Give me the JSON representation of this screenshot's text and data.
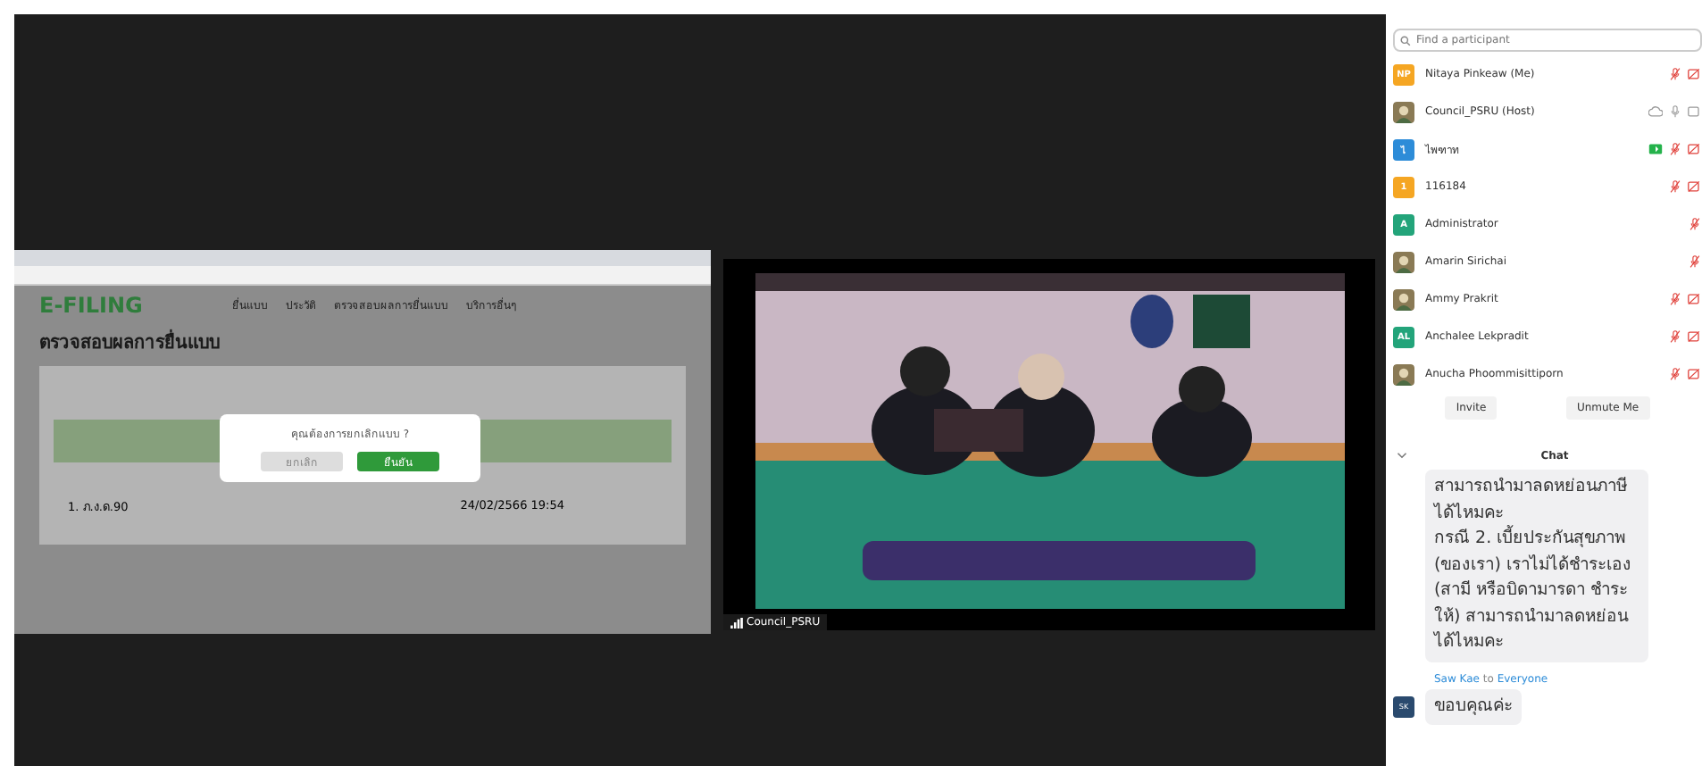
{
  "screen_share": {
    "page": {
      "logo": "E-FILING",
      "nav": [
        "ยื่นแบบ",
        "ประวัติ",
        "ตรวจสอบผลการยื่นแบบ",
        "บริการอื่นๆ"
      ],
      "heading": "ตรวจสอบผลการยื่นแบบ",
      "row": {
        "form": "1. ภ.ง.ด.90",
        "date": "24/02/2566 19:54"
      }
    },
    "dialog": {
      "message": "คุณต้องการยกเลิกแบบ ?",
      "buttons": [
        {
          "label": "ยกเลิก",
          "kind": "cancel"
        },
        {
          "label": "ยืนยัน",
          "kind": "confirm"
        }
      ]
    }
  },
  "video": {
    "kind": "picture",
    "name": "Council_PSRU"
  },
  "participants": {
    "search": {
      "placeholder": "Find a participant"
    },
    "items": [
      {
        "name": "Nitaya Pinkeaw (Me)",
        "avatar": {
          "kind": "initials",
          "text": "NP",
          "color": "#f5a623"
        },
        "mic_muted": true,
        "video_off": true,
        "cloud": false,
        "sharing": false
      },
      {
        "name": "Council_PSRU (Host)",
        "mic_muted": false,
        "video_off": false,
        "cloud": true,
        "sharing": false
      },
      {
        "name": "ไพฑาท",
        "avatar": {
          "kind": "initials",
          "text": "ไ",
          "color": "#2d8cd8"
        },
        "mic_muted": true,
        "video_off": true,
        "cloud": false,
        "sharing": true
      },
      {
        "name": "116184",
        "avatar": {
          "kind": "initials",
          "text": "1",
          "color": "#f5a623"
        },
        "mic_muted": true,
        "video_off": true,
        "cloud": false,
        "sharing": false
      },
      {
        "name": "Administrator",
        "avatar": {
          "kind": "initials",
          "text": "A",
          "color": "#23a47a"
        },
        "mic_muted": true,
        "cloud": false,
        "sharing": false
      },
      {
        "name": "Amarin Sirichai",
        "mic_muted": true,
        "cloud": false,
        "sharing": false
      },
      {
        "name": "Ammy Prakrit",
        "mic_muted": true,
        "video_off": true,
        "cloud": false,
        "sharing": false
      },
      {
        "name": "Anchalee Lekpradit",
        "avatar": {
          "kind": "initials",
          "text": "AL",
          "color": "#23a47a"
        },
        "mic_muted": true,
        "video_off": true,
        "cloud": false,
        "sharing": false
      },
      {
        "name": "Anucha Phoommisittiporn",
        "mic_muted": true,
        "video_off": true,
        "cloud": false,
        "sharing": false
      }
    ],
    "buttons": [
      "Invite",
      "Unmute Me"
    ]
  },
  "chat": {
    "title": "Chat",
    "messages": [
      {
        "lines": [
          "สามารถนำมาลดหย่อนภาษีได้ไหมคะ",
          "กรณี 2. เบี้ยประกันสุขภาพ (ของเรา) เราไม่ได้ชำระเอง (สามี หรือบิดามารดา ชำระให้) สามารถนำมาลดหย่อนได้ไหมคะ"
        ]
      },
      {
        "sender": {
          "name": "Saw Kae",
          "to_word": "to",
          "to": "Everyone",
          "initials": "SK"
        },
        "lines": [
          "ขอบคุณค่ะ"
        ]
      }
    ]
  }
}
